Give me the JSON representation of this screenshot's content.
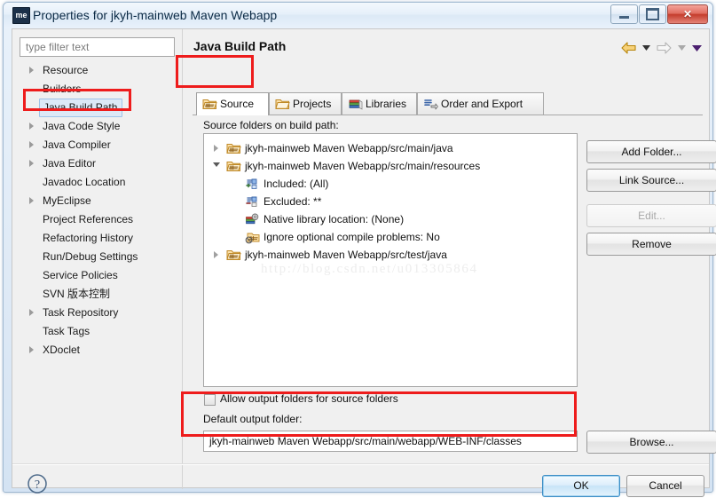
{
  "window": {
    "title": "Properties for jkyh-mainweb Maven Webapp",
    "app_icon_label": "me",
    "buttons": {
      "minimize": "minimize",
      "maximize": "maximize",
      "close": "✕"
    }
  },
  "sidebar": {
    "filter_placeholder": "type filter text",
    "items": [
      {
        "label": "Resource",
        "expandable": true,
        "selected": false
      },
      {
        "label": "Builders",
        "expandable": false,
        "selected": false
      },
      {
        "label": "Java Build Path",
        "expandable": false,
        "selected": true
      },
      {
        "label": "Java Code Style",
        "expandable": true,
        "selected": false
      },
      {
        "label": "Java Compiler",
        "expandable": true,
        "selected": false
      },
      {
        "label": "Java Editor",
        "expandable": true,
        "selected": false
      },
      {
        "label": "Javadoc Location",
        "expandable": false,
        "selected": false
      },
      {
        "label": "MyEclipse",
        "expandable": true,
        "selected": false
      },
      {
        "label": "Project References",
        "expandable": false,
        "selected": false
      },
      {
        "label": "Refactoring History",
        "expandable": false,
        "selected": false
      },
      {
        "label": "Run/Debug Settings",
        "expandable": false,
        "selected": false
      },
      {
        "label": "Service Policies",
        "expandable": false,
        "selected": false
      },
      {
        "label": "SVN 版本控制",
        "expandable": false,
        "selected": false
      },
      {
        "label": "Task Repository",
        "expandable": true,
        "selected": false
      },
      {
        "label": "Task Tags",
        "expandable": false,
        "selected": false
      },
      {
        "label": "XDoclet",
        "expandable": true,
        "selected": false
      }
    ]
  },
  "main": {
    "title": "Java Build Path",
    "nav": {
      "back": "back-arrow",
      "back_menu": "back-dropdown",
      "forward": "forward-arrow",
      "forward_menu": "forward-dropdown",
      "view_menu": "view-menu"
    },
    "tabs": [
      {
        "label": "Source",
        "icon": "source-folder-icon",
        "active": true
      },
      {
        "label": "Projects",
        "icon": "open-folder-icon",
        "active": false
      },
      {
        "label": "Libraries",
        "icon": "library-books-icon",
        "active": false
      },
      {
        "label": "Order and Export",
        "icon": "order-export-icon",
        "active": false
      }
    ],
    "list_label": "Source folders on build path:",
    "tree": [
      {
        "label": "jkyh-mainweb Maven Webapp/src/main/java",
        "icon": "source-folder-icon",
        "indent": 0,
        "twisty": "closed"
      },
      {
        "label": "jkyh-mainweb Maven Webapp/src/main/resources",
        "icon": "source-folder-icon",
        "indent": 0,
        "twisty": "open"
      },
      {
        "label": "Included: (All)",
        "icon": "include-filter-icon",
        "indent": 1,
        "twisty": "none"
      },
      {
        "label": "Excluded: **",
        "icon": "exclude-filter-icon",
        "indent": 1,
        "twisty": "none"
      },
      {
        "label": "Native library location: (None)",
        "icon": "native-library-icon",
        "indent": 1,
        "twisty": "none"
      },
      {
        "label": "Ignore optional compile problems: No",
        "icon": "ignore-problems-icon",
        "indent": 1,
        "twisty": "none"
      },
      {
        "label": "jkyh-mainweb Maven Webapp/src/test/java",
        "icon": "source-folder-icon",
        "indent": 0,
        "twisty": "closed"
      }
    ],
    "watermark": "http://blog.csdn.net/u013305864",
    "side_buttons": [
      {
        "label": "Add Folder...",
        "disabled": false
      },
      {
        "label": "Link Source...",
        "disabled": false
      },
      {
        "label": "Edit...",
        "disabled": true
      },
      {
        "label": "Remove",
        "disabled": false
      }
    ],
    "allow_output_checkbox": {
      "label": "Allow output folders for source folders",
      "checked": false
    },
    "default_output_label": "Default output folder:",
    "default_output_value": "jkyh-mainweb Maven Webapp/src/main/webapp/WEB-INF/classes",
    "browse_label": "Browse..."
  },
  "footer": {
    "help": "?",
    "ok": "OK",
    "cancel": "Cancel"
  },
  "annotations": {
    "accent_color": "#ee1c1c",
    "boxes": [
      {
        "name": "sidebar-java-build-path-highlight"
      },
      {
        "name": "source-tab-highlight"
      },
      {
        "name": "default-output-folder-highlight"
      }
    ]
  }
}
